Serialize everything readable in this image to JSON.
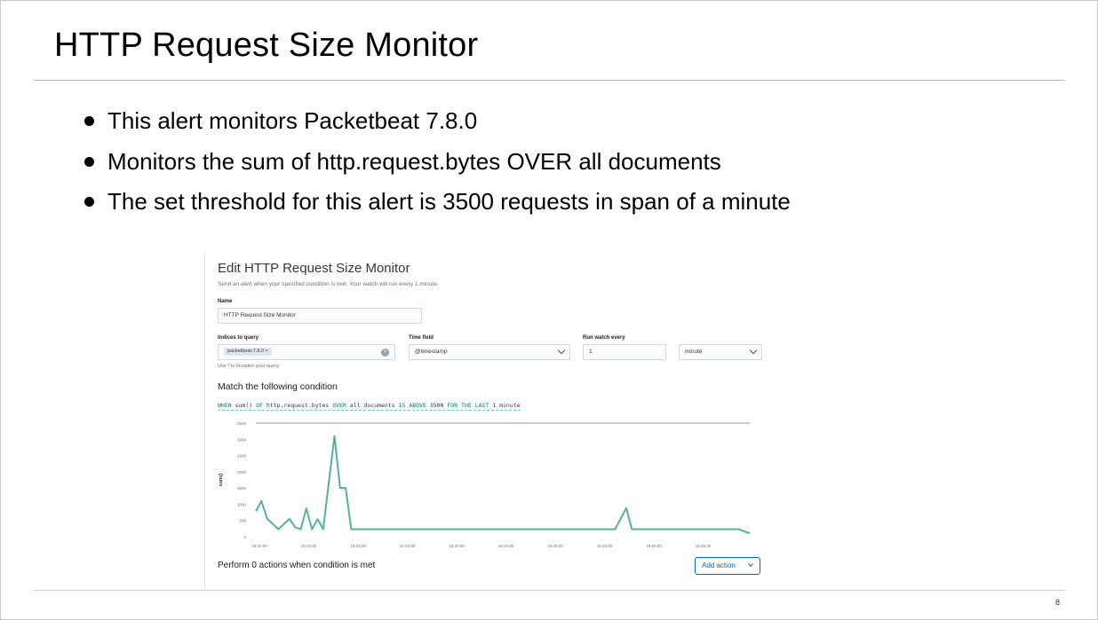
{
  "slide": {
    "title": "HTTP Request Size Monitor",
    "bullets": [
      "This alert monitors Packetbeat 7.8.0",
      "Monitors the sum of http.request.bytes OVER all documents",
      "The set threshold for this alert is 3500 requests in span of a minute"
    ],
    "page_number": "8"
  },
  "screenshot": {
    "heading": "Edit HTTP Request Size Monitor",
    "subtitle": "Send an alert when your specified condition is met. Your watch will run every 1 minute.",
    "name_label": "Name",
    "name_value": "HTTP Request Size Monitor",
    "indices_label": "Indices to query",
    "index_badge": "packetbeat-7.8.0 ×",
    "time_field_label": "Time field",
    "time_field_value": "@timestamp",
    "run_label": "Run watch every",
    "run_value": "1",
    "run_unit": "minute",
    "hint": "Use * to broaden your query.",
    "condition_heading": "Match the following condition",
    "expression": {
      "when": "WHEN",
      "agg": "sum()",
      "of": "OF",
      "field": "http.request.bytes",
      "over": "OVER",
      "scope": "all documents",
      "is": "IS ABOVE",
      "threshold": "3500",
      "for": "FOR THE LAST",
      "window": "1 minute"
    },
    "footer_text": "Perform 0 actions when condition is met",
    "add_action_label": "Add action",
    "accent_color": "#54b399"
  },
  "chart_data": {
    "type": "line",
    "ylabel": "sum()",
    "ylim": [
      0,
      3500
    ],
    "yticks": [
      "0",
      "500",
      "1000",
      "1500",
      "2000",
      "2500",
      "3000",
      "3500"
    ],
    "xticks": [
      "16:22:00",
      "16:22:30",
      "16:23:00",
      "16:23:30",
      "16:24:00",
      "16:24:30",
      "16:25:00",
      "16:25:30",
      "16:26:00",
      "16:26:30"
    ],
    "threshold": 3500,
    "series": [
      {
        "x": [
          0,
          0.5,
          1,
          2,
          3,
          3.5,
          4,
          4.5,
          5,
          5.5,
          6,
          7,
          7.5,
          8,
          8.5,
          9,
          10,
          15,
          20,
          25,
          30,
          32,
          33,
          33.5,
          34,
          35,
          40,
          43,
          44
        ],
        "values": [
          780,
          1100,
          560,
          230,
          550,
          290,
          230,
          870,
          230,
          540,
          230,
          3100,
          1500,
          1500,
          230,
          230,
          230,
          230,
          230,
          230,
          230,
          230,
          880,
          230,
          230,
          230,
          230,
          230,
          100
        ]
      }
    ]
  }
}
